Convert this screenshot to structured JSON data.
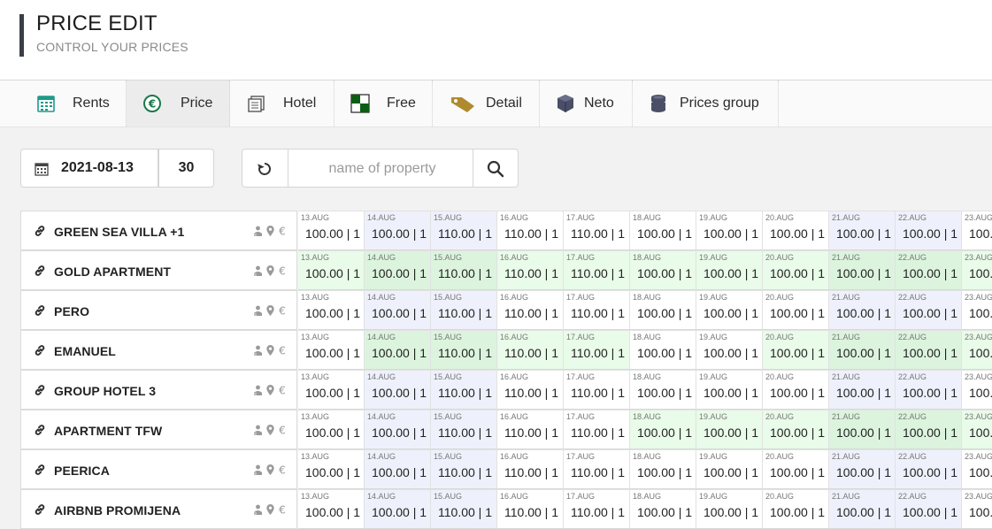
{
  "header": {
    "title": "PRICE EDIT",
    "subtitle": "CONTROL YOUR PRICES"
  },
  "tabs": [
    {
      "label": "Rents",
      "icon": "calendar-icon"
    },
    {
      "label": "Price",
      "icon": "euro-icon",
      "active": true
    },
    {
      "label": "Hotel",
      "icon": "hotel-icon"
    },
    {
      "label": "Free",
      "icon": "checker-icon"
    },
    {
      "label": "Detail",
      "icon": "tag-icon"
    },
    {
      "label": "Neto",
      "icon": "cube-icon"
    },
    {
      "label": "Prices group",
      "icon": "coins-icon"
    }
  ],
  "toolbar": {
    "date": "2021-08-13",
    "days": "30",
    "search_placeholder": "name of property"
  },
  "dates": [
    "13.AUG",
    "14.AUG",
    "15.AUG",
    "16.AUG",
    "17.AUG",
    "18.AUG",
    "19.AUG",
    "20.AUG",
    "21.AUG",
    "22.AUG",
    "23.AUG"
  ],
  "rows": [
    {
      "name": "GREEN SEA VILLA +1",
      "prices": [
        "100.00 | 1",
        "100.00 | 1",
        "110.00 | 1",
        "110.00 | 1",
        "110.00 | 1",
        "100.00 | 1",
        "100.00 | 1",
        "100.00 | 1",
        "100.00 | 1",
        "100.00 | 1",
        "100."
      ],
      "colors": [
        "white",
        "blue",
        "blue",
        "white",
        "white",
        "white",
        "white",
        "white",
        "blue",
        "blue",
        "white"
      ]
    },
    {
      "name": "GOLD APARTMENT",
      "prices": [
        "100.00 | 1",
        "100.00 | 1",
        "110.00 | 1",
        "110.00 | 1",
        "110.00 | 1",
        "100.00 | 1",
        "100.00 | 1",
        "100.00 | 1",
        "100.00 | 1",
        "100.00 | 1",
        "100."
      ],
      "colors": [
        "green",
        "green2",
        "green2",
        "green",
        "green",
        "green",
        "green",
        "green",
        "green2",
        "green2",
        "green"
      ]
    },
    {
      "name": "PERO",
      "prices": [
        "100.00 | 1",
        "100.00 | 1",
        "110.00 | 1",
        "110.00 | 1",
        "110.00 | 1",
        "100.00 | 1",
        "100.00 | 1",
        "100.00 | 1",
        "100.00 | 1",
        "100.00 | 1",
        "100."
      ],
      "colors": [
        "white",
        "blue",
        "blue",
        "white",
        "white",
        "white",
        "white",
        "white",
        "blue",
        "blue",
        "white"
      ]
    },
    {
      "name": "EMANUEL",
      "prices": [
        "100.00 | 1",
        "100.00 | 1",
        "110.00 | 1",
        "110.00 | 1",
        "110.00 | 1",
        "100.00 | 1",
        "100.00 | 1",
        "100.00 | 1",
        "100.00 | 1",
        "100.00 | 1",
        "100."
      ],
      "colors": [
        "white",
        "green2",
        "green2",
        "green",
        "green",
        "white",
        "white",
        "green",
        "green2",
        "green2",
        "green"
      ]
    },
    {
      "name": "GROUP HOTEL 3",
      "prices": [
        "100.00 | 1",
        "100.00 | 1",
        "110.00 | 1",
        "110.00 | 1",
        "110.00 | 1",
        "100.00 | 1",
        "100.00 | 1",
        "100.00 | 1",
        "100.00 | 1",
        "100.00 | 1",
        "100."
      ],
      "colors": [
        "white",
        "blue",
        "blue",
        "white",
        "white",
        "white",
        "white",
        "white",
        "blue",
        "blue",
        "white"
      ]
    },
    {
      "name": "APARTMENT TFW",
      "prices": [
        "100.00 | 1",
        "100.00 | 1",
        "110.00 | 1",
        "110.00 | 1",
        "110.00 | 1",
        "100.00 | 1",
        "100.00 | 1",
        "100.00 | 1",
        "100.00 | 1",
        "100.00 | 1",
        "100."
      ],
      "colors": [
        "white",
        "blue",
        "blue",
        "white",
        "white",
        "green",
        "green",
        "green",
        "green2",
        "green2",
        "green"
      ]
    },
    {
      "name": "PEERICA",
      "prices": [
        "100.00 | 1",
        "100.00 | 1",
        "110.00 | 1",
        "110.00 | 1",
        "110.00 | 1",
        "100.00 | 1",
        "100.00 | 1",
        "100.00 | 1",
        "100.00 | 1",
        "100.00 | 1",
        "100."
      ],
      "colors": [
        "white",
        "blue",
        "blue",
        "white",
        "white",
        "white",
        "white",
        "white",
        "blue",
        "blue",
        "white"
      ]
    },
    {
      "name": "AIRBNB PROMIJENA",
      "prices": [
        "100.00 | 1",
        "100.00 | 1",
        "110.00 | 1",
        "110.00 | 1",
        "110.00 | 1",
        "100.00 | 1",
        "100.00 | 1",
        "100.00 | 1",
        "100.00 | 1",
        "100.00 | 1",
        "100."
      ],
      "colors": [
        "white",
        "blue",
        "blue",
        "white",
        "white",
        "white",
        "white",
        "white",
        "blue",
        "blue",
        "white"
      ]
    }
  ]
}
